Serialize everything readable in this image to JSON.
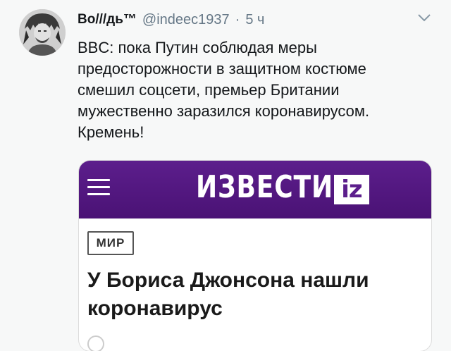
{
  "tweet": {
    "display_name": "Во///дь™",
    "handle": "@indeec1937",
    "separator": "·",
    "time": "5 ч",
    "text_lines": [
      "BBC: пока Путин соблюдая меры",
      "предосторожности в защитном костюме",
      "смешил соцсети, премьер Британии",
      "мужественно заразился коронавирусом.",
      "Кремень!"
    ],
    "avatar_icon": "avatar-portrait-icon",
    "caret_icon": "chevron-down-icon"
  },
  "card": {
    "brand": "ИЗВЕСТИЯ",
    "brand_badge": "iz",
    "category": "МИР",
    "headline_lines": [
      "У Бориса Джонсона нашли",
      "коронавирус"
    ],
    "menu_icon": "hamburger-menu-icon",
    "colors": {
      "header_bg": "#5c1e8c",
      "badge_bg": "#ffffff"
    }
  }
}
